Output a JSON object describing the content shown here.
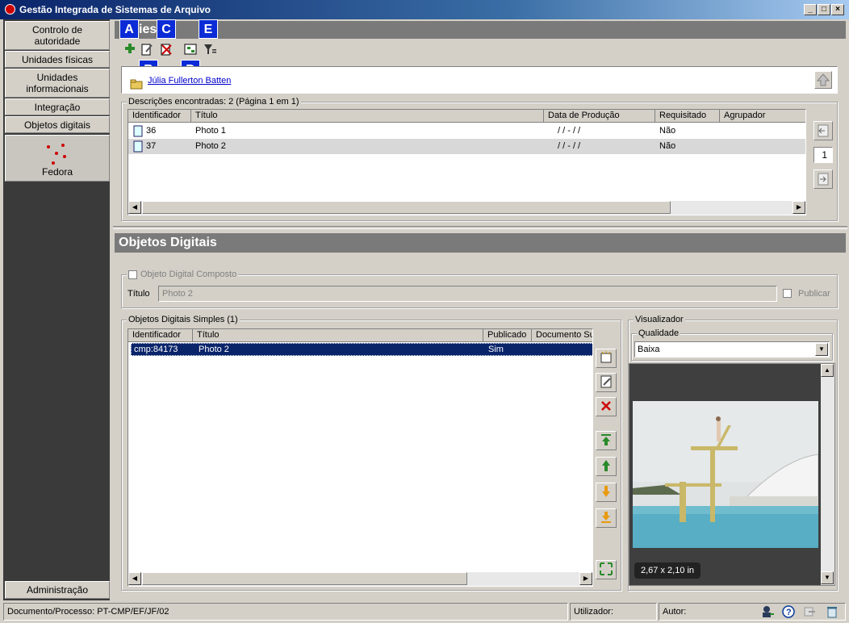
{
  "window": {
    "title": "Gestão Integrada de Sistemas de Arquivo",
    "minimize": "_",
    "maximize": "□",
    "close": "×"
  },
  "sidebar": {
    "items": [
      {
        "label": "Controlo de autoridade"
      },
      {
        "label": "Unidades físicas"
      },
      {
        "label": "Unidades informacionais"
      },
      {
        "label": "Integração"
      },
      {
        "label": "Objetos digitais"
      }
    ],
    "active": {
      "label": "Fedora"
    },
    "bottom": {
      "label": "Administração"
    }
  },
  "top_panel": {
    "title_partial": "ies",
    "badges": [
      "A",
      "B",
      "C",
      "D",
      "E"
    ],
    "context_link": "Júlia Fullerton Batten",
    "results_legend": "Descrições encontradas: 2 (Página 1 em 1)",
    "columns": [
      "Identificador",
      "Título",
      "Data de Produção",
      "Requisitado",
      "Agrupador"
    ],
    "rows": [
      {
        "id": "36",
        "title": "Photo 1",
        "date": "/ /  -  / /",
        "requested": "Não",
        "group": ""
      },
      {
        "id": "37",
        "title": "Photo 2",
        "date": "/ /  -  / /",
        "requested": "Não",
        "group": ""
      }
    ],
    "page_number": "1"
  },
  "digital_objects": {
    "header": "Objetos Digitais",
    "composite_label": "Objeto Digital Composto",
    "title_label": "Título",
    "title_value": "Photo 2",
    "publish_label": "Publicar",
    "simple_legend": "Objetos Digitais Simples (1)",
    "columns": [
      "Identificador",
      "Título",
      "Publicado",
      "Documento Su"
    ],
    "rows": [
      {
        "id": "cmp:84173",
        "title": "Photo 2",
        "published": "Sim",
        "doc": ""
      }
    ]
  },
  "viewer": {
    "legend": "Visualizador",
    "quality_legend": "Qualidade",
    "quality_value": "Baixa",
    "dimensions": "2,67 x 2,10 in"
  },
  "statusbar": {
    "document": "Documento/Processo: PT-CMP/EF/JF/02",
    "user_label": "Utilizador:",
    "author_label": "Autor:"
  },
  "colors": {
    "selection": "#0a246a",
    "header_gray": "#7a7a7a",
    "sidebar_dark": "#3a3a3a",
    "badge_blue": "#0a2bd6"
  }
}
